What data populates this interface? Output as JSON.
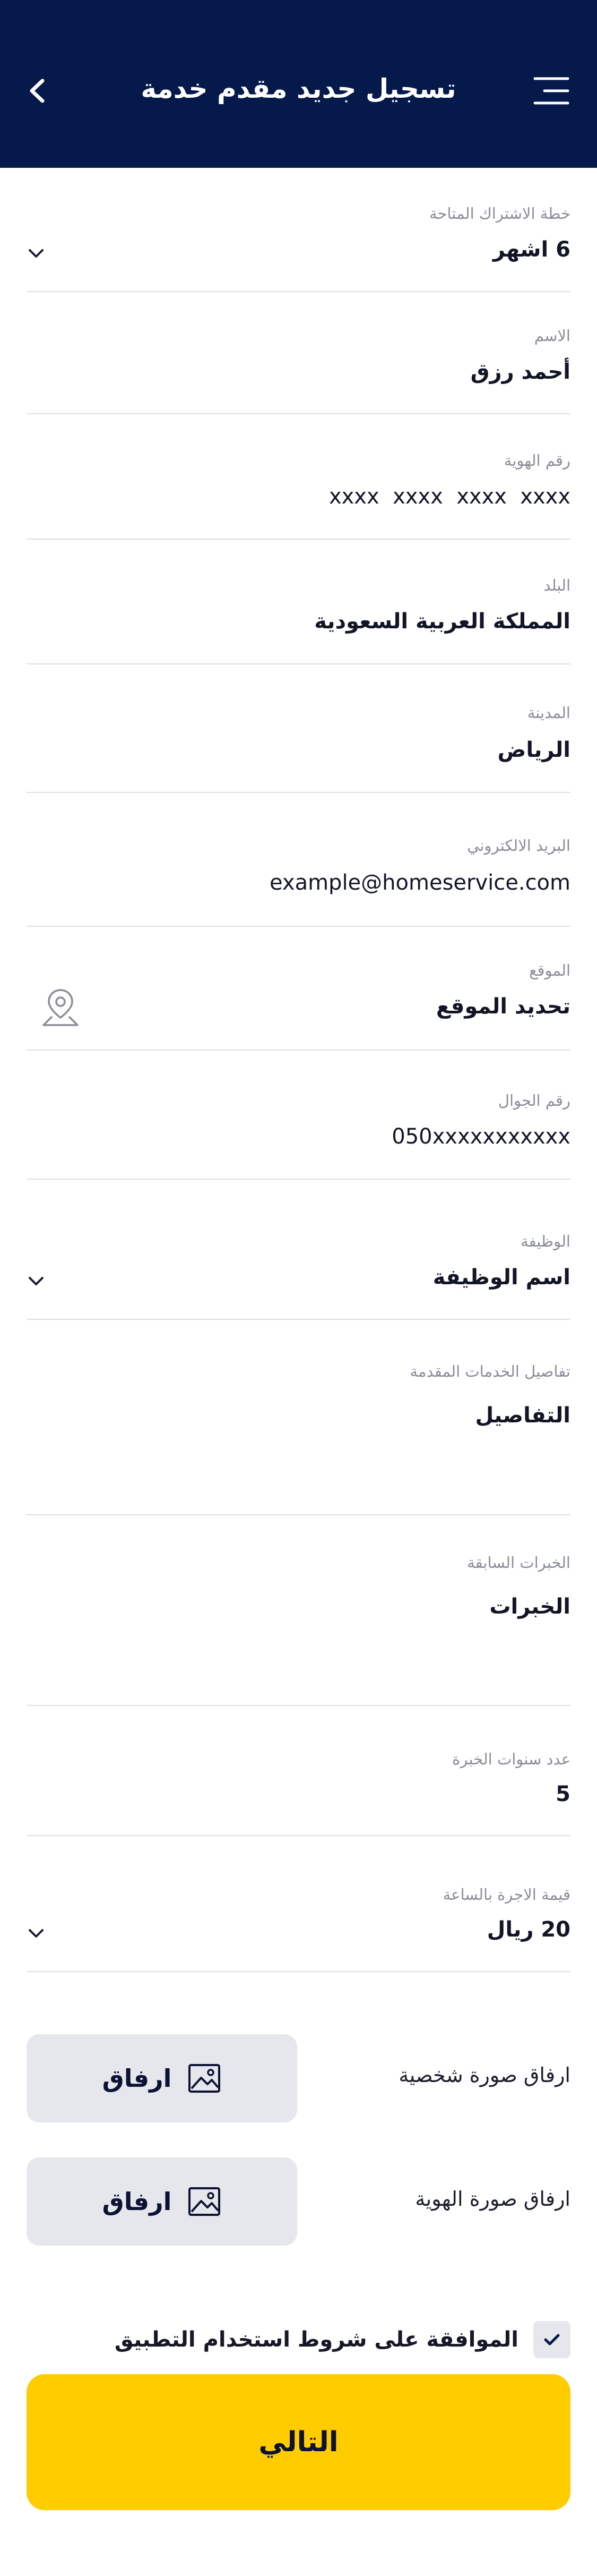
{
  "header": {
    "title": "تسجيل جديد مقدم خدمة"
  },
  "fields": {
    "plan": {
      "label": "خطة الاشتراك المتاحة",
      "value": "6 اشهر"
    },
    "name": {
      "label": "الاسم",
      "value": "أحمد رزق"
    },
    "id_number": {
      "label": "رقم الهوية",
      "value": "xxxx  xxxx  xxxx  xxxx"
    },
    "country": {
      "label": "البلد",
      "value": "المملكة العربية السعودية"
    },
    "city": {
      "label": "المدينة",
      "value": "الرياض"
    },
    "email": {
      "label": "البريد الالكتروني",
      "value": "example@homeservice.com"
    },
    "location": {
      "label": "الموقع",
      "value": "تحديد الموقع"
    },
    "phone": {
      "label": "رقم الجوال",
      "value": "050xxxxxxxxxxx"
    },
    "job": {
      "label": "الوظيفة",
      "value": "اسم الوظيفة"
    },
    "services": {
      "label": "تفاصيل الخدمات المقدمة",
      "value": "التفاصيل"
    },
    "experience": {
      "label": "الخبرات السابقة",
      "value": "الخبرات"
    },
    "years": {
      "label": "عدد سنوات الخبرة",
      "value": "5"
    },
    "rate": {
      "label": "قيمة الاجرة بالساعة",
      "value": "20 ريال"
    }
  },
  "attachments": {
    "photo_label": "ارفاق صورة شخصية",
    "id_label": "ارفاق صورة الهوية",
    "button_label": "ارفاق"
  },
  "terms": {
    "label": "الموافقة على شروط استخدام التطبيق",
    "checked": true
  },
  "next_button": "التالي",
  "colors": {
    "header_bg": "#05194a",
    "accent": "#ffcc00",
    "button_bg": "#e6e7ec"
  },
  "icons": [
    "menu-icon",
    "back-arrow-icon",
    "chevron-down-icon",
    "location-pin-icon",
    "image-icon",
    "check-icon"
  ]
}
